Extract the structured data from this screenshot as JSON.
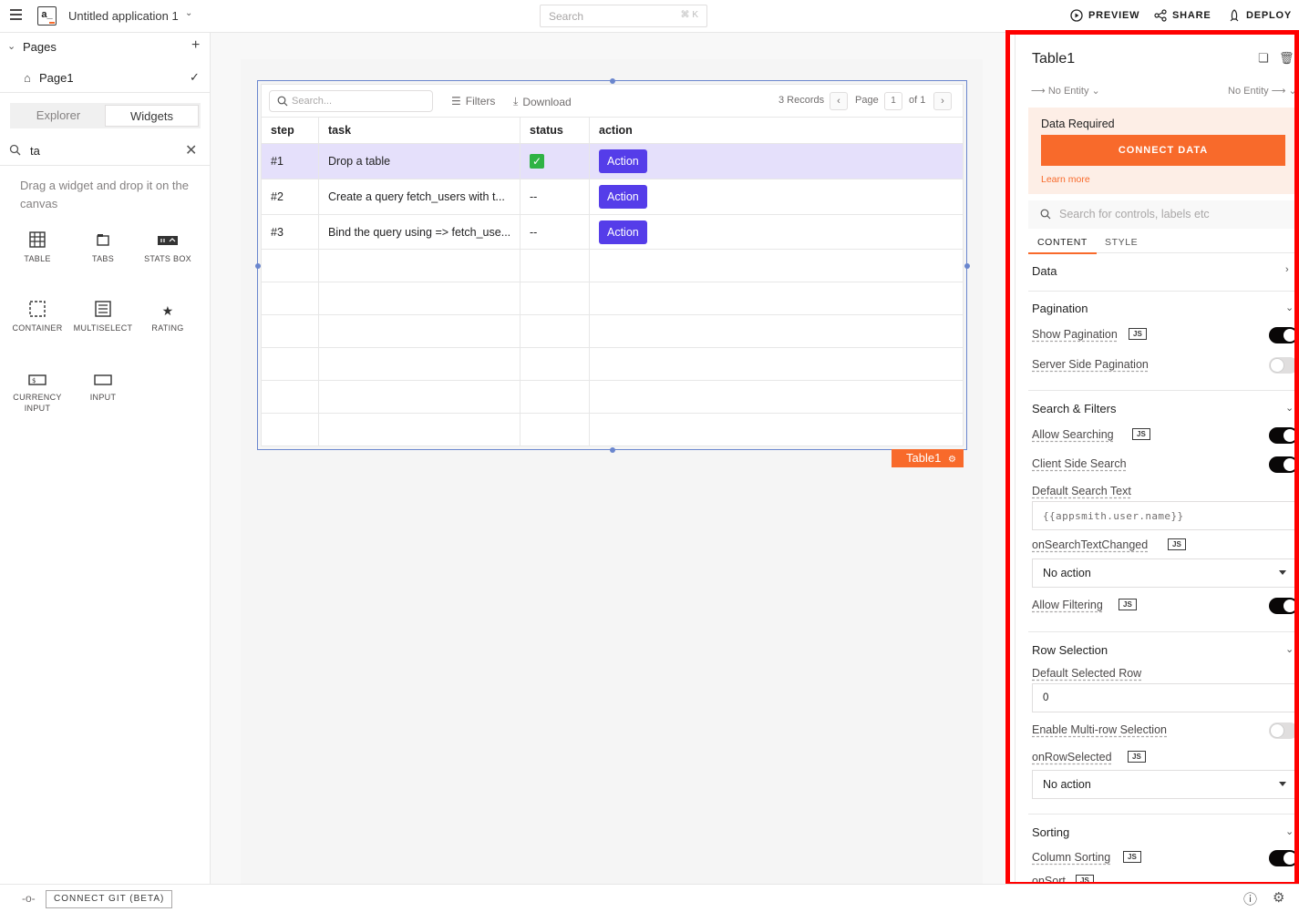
{
  "topbar": {
    "app_name": "Untitled application 1",
    "search_placeholder": "Search",
    "search_shortcut": "⌘ K",
    "preview": "PREVIEW",
    "share": "SHARE",
    "deploy": "DEPLOY",
    "logo_text": "a_"
  },
  "sidebar": {
    "pages_label": "Pages",
    "page_name": "Page1",
    "tab_explorer": "Explorer",
    "tab_widgets": "Widgets",
    "search_value": "ta",
    "hint": "Drag a widget and drop it on the canvas",
    "widgets": [
      {
        "label": "TABLE",
        "icon": "table-icon"
      },
      {
        "label": "TABS",
        "icon": "tabs-icon"
      },
      {
        "label": "STATS BOX",
        "icon": "stats-box-icon"
      },
      {
        "label": "CONTAINER",
        "icon": "container-icon"
      },
      {
        "label": "MULTISELECT",
        "icon": "multiselect-icon"
      },
      {
        "label": "RATING",
        "icon": "star-icon"
      },
      {
        "label": "CURRENCY INPUT",
        "icon": "currency-input-icon"
      },
      {
        "label": "INPUT",
        "icon": "input-icon"
      }
    ]
  },
  "table": {
    "search_placeholder": "Search...",
    "filters": "Filters",
    "download": "Download",
    "records": "3 Records",
    "page_label": "Page",
    "page_num": "1",
    "of_label": "of 1",
    "columns": [
      "step",
      "task",
      "status",
      "action"
    ],
    "rows": [
      {
        "step": "#1",
        "task": "Drop a table",
        "status": "✓",
        "action": "Action"
      },
      {
        "step": "#2",
        "task": "Create a query fetch_users with t...",
        "status": "--",
        "action": "Action"
      },
      {
        "step": "#3",
        "task": "Bind the query using => fetch_use...",
        "status": "--",
        "action": "Action"
      }
    ],
    "tag_label": "Table1",
    "selection_color": "#e5e0fb",
    "action_color": "#553de9"
  },
  "pane": {
    "title": "Table1",
    "entity_left": "No Entity",
    "entity_right": "No Entity",
    "data_required": "Data Required",
    "connect_data": "CONNECT DATA",
    "learn_more": "Learn more",
    "search_placeholder": "Search for controls, labels etc",
    "tab_content": "CONTENT",
    "tab_style": "STYLE",
    "sections": {
      "data": "Data",
      "pagination": "Pagination",
      "search_filters": "Search & Filters",
      "row_selection": "Row Selection",
      "sorting": "Sorting"
    },
    "props": {
      "show_pagination": "Show Pagination",
      "server_side_pagination": "Server Side Pagination",
      "allow_searching": "Allow Searching",
      "client_side_search": "Client Side Search",
      "default_search_text": "Default Search Text",
      "default_search_value": "{{appsmith.user.name}}",
      "on_search_text_changed": "onSearchTextChanged",
      "no_action_1": "No action",
      "allow_filtering": "Allow Filtering",
      "default_selected_row": "Default Selected Row",
      "default_selected_row_value": "0",
      "enable_multi_row": "Enable Multi-row Selection",
      "on_row_selected": "onRowSelected",
      "no_action_2": "No action",
      "column_sorting": "Column Sorting",
      "on_sort": "onSort",
      "js": "JS"
    },
    "toggles": {
      "show_pagination": true,
      "server_side_pagination": false,
      "allow_searching": true,
      "client_side_search": true,
      "allow_filtering": true,
      "enable_multi_row": false,
      "column_sorting": true
    },
    "accent_color": "#f86a2b",
    "highlight_border_color": "#ff0000"
  },
  "bottombar": {
    "connect_git": "CONNECT GIT (BETA)"
  }
}
